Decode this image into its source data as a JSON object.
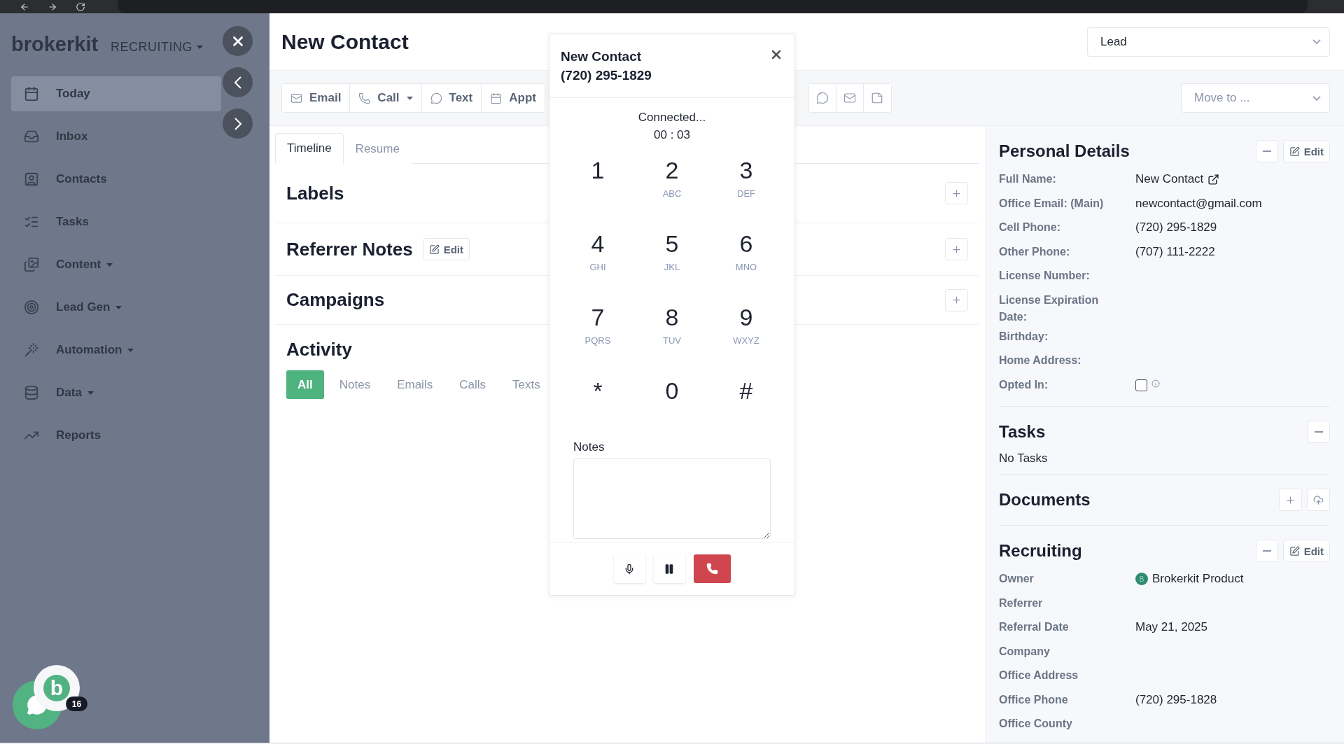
{
  "background_app": {
    "logo": "brokerkit",
    "workspace": "RECRUITING",
    "nav": [
      {
        "label": "Today",
        "has_menu": false,
        "selected": true
      },
      {
        "label": "Inbox",
        "has_menu": false,
        "selected": false
      },
      {
        "label": "Contacts",
        "has_menu": false,
        "selected": false
      },
      {
        "label": "Tasks",
        "has_menu": false,
        "selected": false
      },
      {
        "label": "Content",
        "has_menu": true,
        "selected": false
      },
      {
        "label": "Lead Gen",
        "has_menu": true,
        "selected": false
      },
      {
        "label": "Automation",
        "has_menu": true,
        "selected": false
      },
      {
        "label": "Data",
        "has_menu": true,
        "selected": false
      },
      {
        "label": "Reports",
        "has_menu": false,
        "selected": false
      }
    ]
  },
  "contact": {
    "title": "New Contact",
    "stage": "Lead"
  },
  "actions": [
    {
      "label": "Email",
      "has_menu": false
    },
    {
      "label": "Call",
      "has_menu": true
    },
    {
      "label": "Text",
      "has_menu": false
    },
    {
      "label": "Appt",
      "has_menu": false
    }
  ],
  "move_to": {
    "placeholder": "Move to ..."
  },
  "tabs": [
    {
      "label": "Timeline",
      "selected": true
    },
    {
      "label": "Resume",
      "selected": false
    }
  ],
  "sections": [
    {
      "title": "Labels"
    },
    {
      "title": "Referrer Notes",
      "edit_label": "Edit"
    },
    {
      "title": "Campaigns"
    }
  ],
  "activity": {
    "title": "Activity",
    "filters": [
      {
        "label": "All",
        "selected": true
      },
      {
        "label": "Notes",
        "selected": false
      },
      {
        "label": "Emails",
        "selected": false
      },
      {
        "label": "Calls",
        "selected": false
      },
      {
        "label": "Texts",
        "selected": false
      }
    ]
  },
  "personal_details": {
    "title": "Personal Details",
    "edit_label": "Edit",
    "fields": [
      {
        "label": "Full Name:",
        "kind": "link",
        "value": "New Contact"
      },
      {
        "label": "Office Email: (Main)",
        "kind": "text",
        "value": "newcontact@gmail.com"
      },
      {
        "label": "Cell Phone:",
        "kind": "text",
        "value": "(720) 295-1829"
      },
      {
        "label": "Other Phone:",
        "kind": "text",
        "value": "(707) 111-2222"
      },
      {
        "label": "License Number:",
        "kind": "text"
      },
      {
        "label": "License Expiration Date:",
        "kind": "text"
      },
      {
        "label": "Birthday:",
        "kind": "text"
      },
      {
        "label": "Home Address:",
        "kind": "text"
      },
      {
        "label": "Opted In:",
        "kind": "checkbox",
        "checked": false
      }
    ]
  },
  "tasks": {
    "title": "Tasks",
    "empty_text": "No Tasks"
  },
  "documents": {
    "title": "Documents"
  },
  "recruiting": {
    "title": "Recruiting",
    "edit_label": "Edit",
    "fields": [
      {
        "label": "Owner",
        "kind": "owner",
        "avatar": "B",
        "value": "Brokerkit Product"
      },
      {
        "label": "Referrer",
        "kind": "text"
      },
      {
        "label": "Referral Date",
        "kind": "text",
        "value": "May 21, 2025"
      },
      {
        "label": "Company",
        "kind": "text"
      },
      {
        "label": "Office Address",
        "kind": "text"
      },
      {
        "label": "Office Phone",
        "kind": "text",
        "value": "(720) 295-1828"
      },
      {
        "label": "Office County",
        "kind": "text"
      }
    ]
  },
  "dialer": {
    "title": "New Contact",
    "number": "(720) 295-1829",
    "status": "Connected...",
    "timer": "00 : 03",
    "keys": [
      {
        "digit": "1"
      },
      {
        "digit": "2",
        "letters": "ABC"
      },
      {
        "digit": "3",
        "letters": "DEF"
      },
      {
        "digit": "4",
        "letters": "GHI"
      },
      {
        "digit": "5",
        "letters": "JKL"
      },
      {
        "digit": "6",
        "letters": "MNO"
      },
      {
        "digit": "7",
        "letters": "PQRS"
      },
      {
        "digit": "8",
        "letters": "TUV"
      },
      {
        "digit": "9",
        "letters": "WXYZ"
      },
      {
        "digit": "*"
      },
      {
        "digit": "0"
      },
      {
        "digit": "#"
      }
    ],
    "notes_label": "Notes"
  },
  "chat_widget": {
    "logo": "b",
    "badge": "16"
  }
}
